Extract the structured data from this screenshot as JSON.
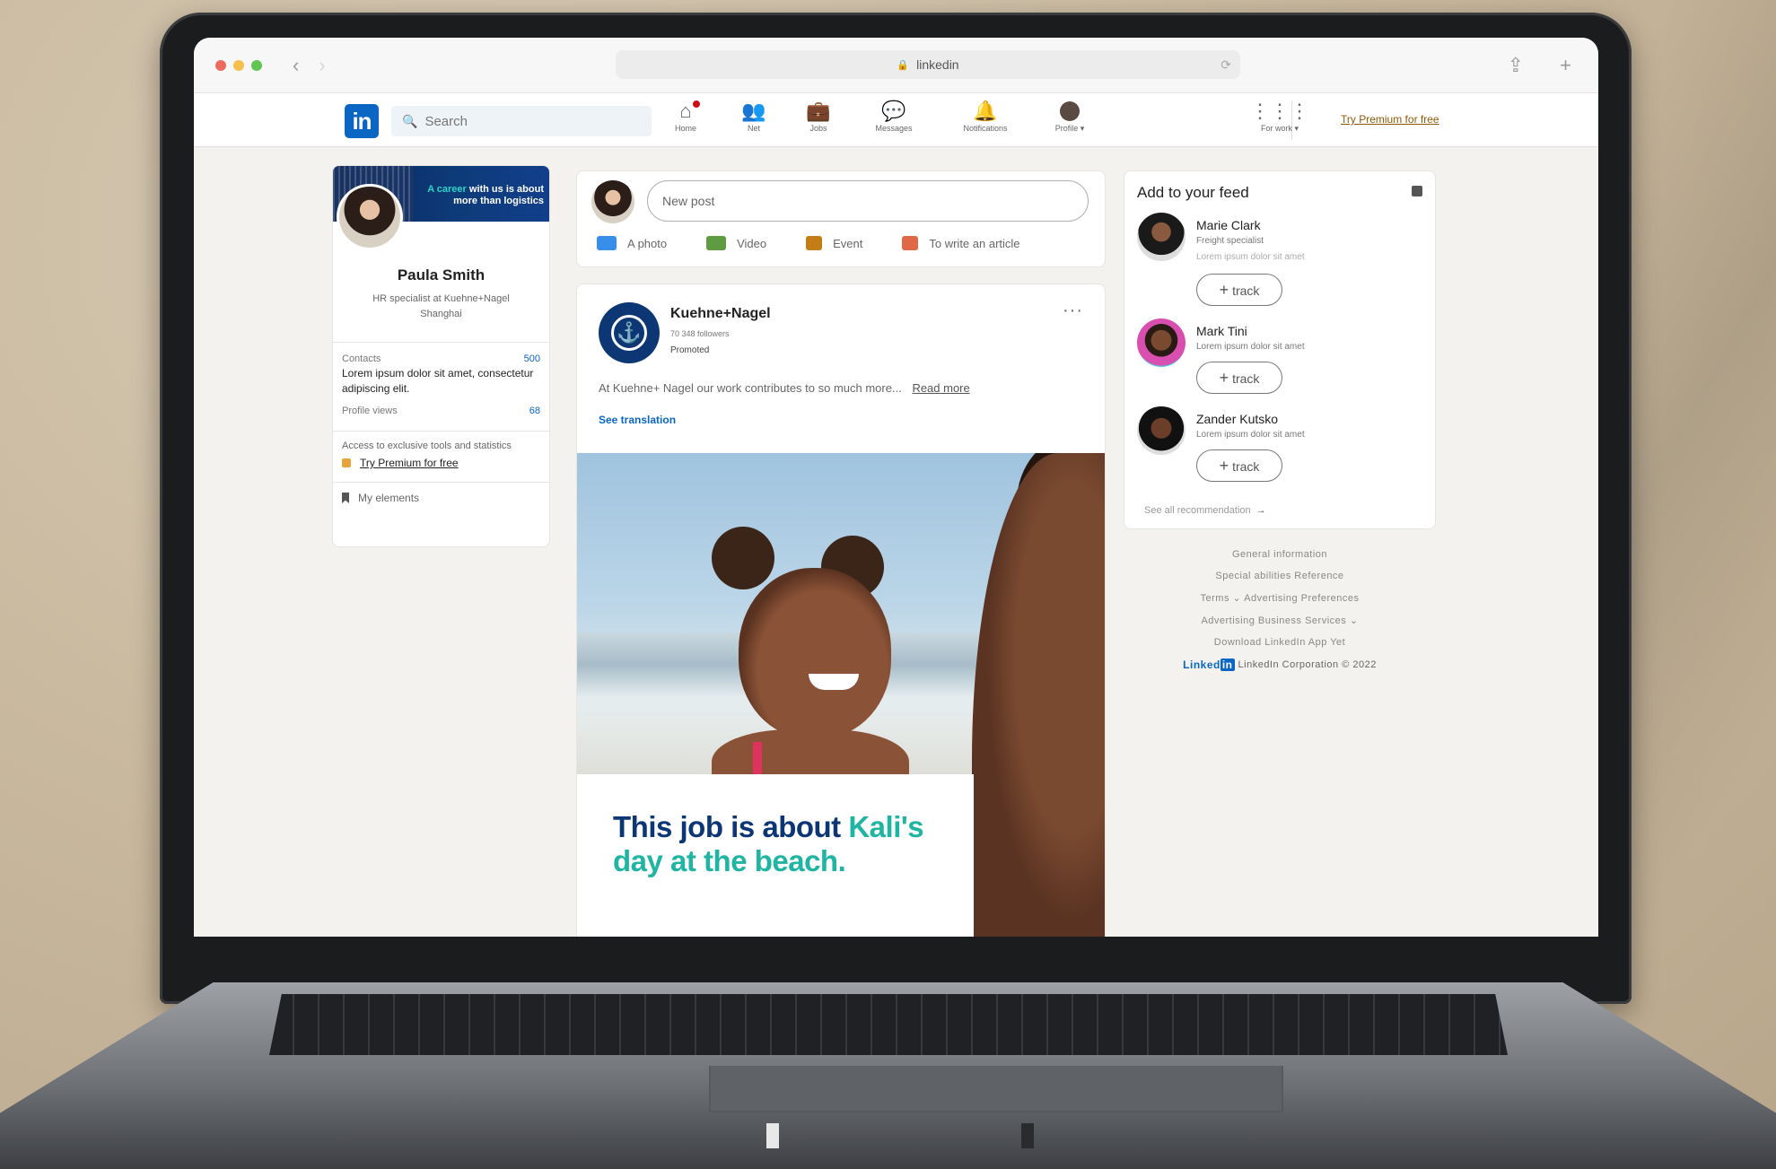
{
  "browser": {
    "url": "linkedin",
    "traffic_colors": [
      "#ec6a5e",
      "#f4bf4f",
      "#61c554"
    ]
  },
  "header": {
    "logo": "in",
    "search_placeholder": "Search",
    "nav": [
      {
        "label": "Home",
        "icon": "home-icon"
      },
      {
        "label": "Net",
        "icon": "network-icon"
      },
      {
        "label": "Jobs",
        "icon": "briefcase-icon"
      },
      {
        "label": "Messages",
        "icon": "message-icon"
      },
      {
        "label": "Notifications",
        "icon": "bell-icon"
      },
      {
        "label": "Profile",
        "icon": "avatar"
      },
      {
        "label": "For work",
        "icon": "grid-icon"
      }
    ],
    "premium": "Try Premium for free"
  },
  "profile": {
    "banner_line1_hl": "A career",
    "banner_line1": " with us is about",
    "banner_line2": "more than logistics",
    "name": "Paula Smith",
    "title": "HR specialist at Kuehne+Nagel Shanghai",
    "contacts_label": "Contacts",
    "contacts_value": "500",
    "contacts_text": "Lorem ipsum dolor sit amet, consectetur adipiscing elit.",
    "views_label": "Profile views",
    "views_value": "68",
    "access_text": "Access to exclusive tools and statistics",
    "premium": "Try Premium for free",
    "my_elements": "My elements"
  },
  "composer": {
    "placeholder": "New post",
    "actions": [
      {
        "label": "A photo",
        "color": "#378fe9"
      },
      {
        "label": "Video",
        "color": "#5f9b41"
      },
      {
        "label": "Event",
        "color": "#c37d16"
      },
      {
        "label": "To write an article",
        "color": "#e06847"
      }
    ]
  },
  "post": {
    "company": "Kuehne+Nagel",
    "followers": "70 348 followers",
    "promoted": "Promoted",
    "text": "At Kuehne+ Nagel our work contributes to so much more...",
    "read_more": "Read more",
    "translate": "See translation",
    "headline_a": "This job is about ",
    "headline_accent": "Kali's",
    "headline_b": "day at the beach."
  },
  "feed": {
    "title": "Add to your feed",
    "recs": [
      {
        "name": "Marie Clark",
        "desc": "Freight specialist",
        "desc2": "Lorem ipsum dolor sit amet",
        "button": "track"
      },
      {
        "name": "Mark Tini",
        "desc": "Lorem ipsum dolor sit amet",
        "desc2": "",
        "button": "track"
      },
      {
        "name": "Zander Kutsko",
        "desc": "Lorem ipsum dolor sit amet",
        "desc2": "",
        "button": "track"
      }
    ],
    "see_all": "See all recommendation"
  },
  "footer": {
    "links": [
      "General information",
      "Special abilities   Reference",
      "Terms ⌄   Advertising Preferences",
      "Advertising   Business Services ⌄",
      "Download LinkedIn App   Yet"
    ],
    "brand": "Linked",
    "brand_box": "in",
    "copyright": "LinkedIn Corporation © 2022"
  }
}
